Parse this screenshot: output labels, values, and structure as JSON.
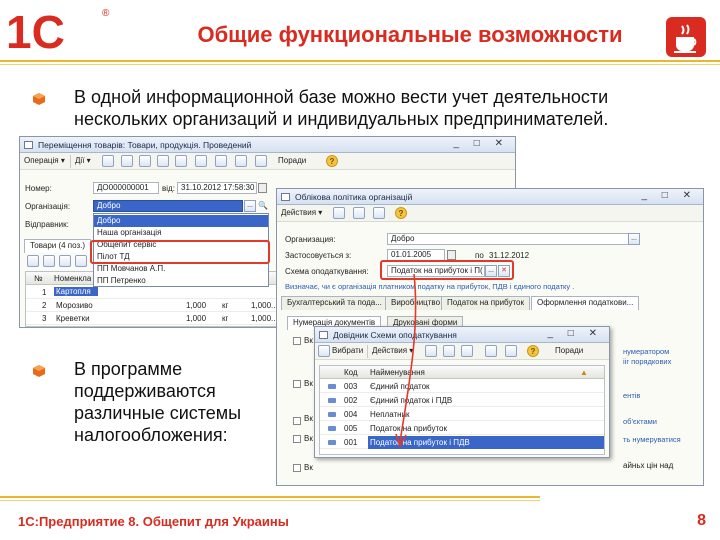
{
  "slide": {
    "logo_text": "1С",
    "logo_mark": "®",
    "title": "Общие функциональные возможности",
    "bullet1": "В одной информационной базе можно вести учет деятельности нескольких организаций и индивидуальных предпринимателей.",
    "bullet2": "В программе поддерживаются различные системы налогообложения:",
    "footer": "1С:Предприятие 8. Общепит для Украины",
    "page_number": "8",
    "accent_color": "#d92b1f",
    "line_color": "#e9b92a"
  },
  "win1": {
    "title": "Переміщення товарів: Товари, продукція. Проведений",
    "title_buttons": "_ □ ✕",
    "toolbar": {
      "operation": "Операція ▾",
      "actions": "Дії ▾",
      "help": "Поради"
    },
    "labels": {
      "number": "Номер:",
      "date_from": "від:",
      "organization": "Організація:",
      "sender": "Відправник:"
    },
    "number_value": "ДО000000001",
    "date_value": "31.10.2012 17:58:30",
    "organization_value": "Добро",
    "ellipsis": "...",
    "tabs": [
      "Товари (4 поз.)"
    ],
    "grid_headers": [
      "№",
      "Номенкла"
    ],
    "rows": [
      {
        "n": "1",
        "name": "Картопля",
        "qty": "",
        "unit": "",
        "sum": ""
      },
      {
        "n": "2",
        "name": "Морозиво",
        "qty": "1,000",
        "unit": "кг",
        "sum": "1,000..."
      },
      {
        "n": "3",
        "name": "Креветки",
        "qty": "1,000",
        "unit": "кг",
        "sum": "1,000..."
      }
    ],
    "dropdown": [
      "Добро",
      "Наша організація",
      "Общепит сервіс",
      "Пілот ТД",
      "ПП Мовчанов А.П.",
      "ПП Петренко"
    ]
  },
  "win2": {
    "title": "Облікова політика організацій",
    "title_buttons": "_ □ ✕",
    "toolbar": {
      "actions": "Действия ▾"
    },
    "labels": {
      "organization": "Организация:",
      "applied": "Застосовується з:",
      "to": "по",
      "scheme": "Схема оподаткування:"
    },
    "organization_value": "Добро",
    "date_from": "01.01.2005",
    "date_to": "31.12.2012",
    "scheme_value": "Податок на прибуток і П(",
    "ellipsis": "...",
    "clear": "✕",
    "info": "Визначає, чи є організація платником податку на прибуток, ПДВ і єдиного податку .",
    "tabs": [
      "Бухгалтерський та пода...",
      "Виробництво",
      "Податок на прибуток",
      "Оформлення податкови..."
    ],
    "subtabs": [
      "Нумерація документів",
      "Друковані форми"
    ],
    "checkbox_labels": [
      "Вк",
      "Вк",
      "Вк ог",
      "Вк",
      "Вк"
    ],
    "right_links": [
      "нумератором",
      "ііг порядкових",
      "ентів",
      "об'єктами",
      "ть нумеруватися",
      "айньх цін над"
    ]
  },
  "win3": {
    "title": "Довідник Схеми оподаткування",
    "title_buttons": "_ □ ✕",
    "toolbar": {
      "select": "Вибрати",
      "actions": "Действия ▾",
      "help": "Поради"
    },
    "grid_headers": [
      "Код",
      "Найменування"
    ],
    "rows": [
      {
        "code": "003",
        "name": "Єдиний податок"
      },
      {
        "code": "002",
        "name": "Єдиний податок і ПДВ"
      },
      {
        "code": "004",
        "name": "Неплатник"
      },
      {
        "code": "005",
        "name": "Податок на прибуток"
      },
      {
        "code": "001",
        "name": "Податок на прибуток і ПДВ"
      }
    ],
    "selected_index": 4
  }
}
